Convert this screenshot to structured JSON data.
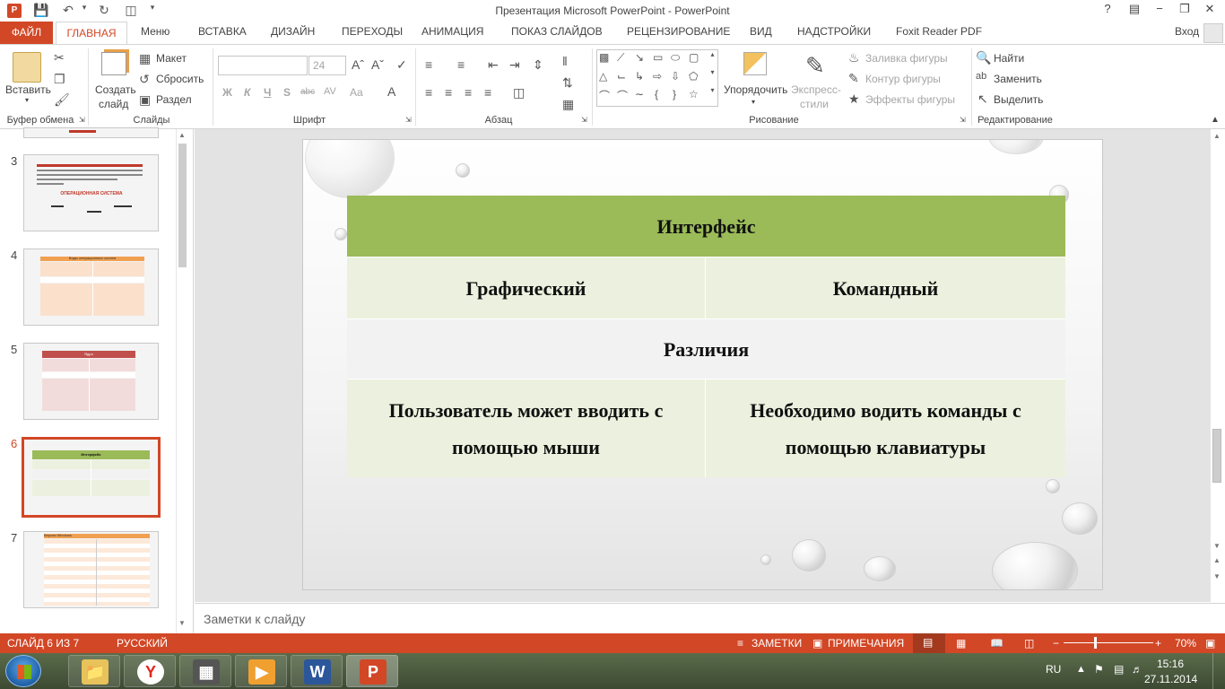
{
  "window": {
    "title": "Презентация Microsoft PowerPoint - PowerPoint",
    "help": "?",
    "minimize": "−",
    "restore": "❐",
    "close": "✕"
  },
  "tabs": {
    "file": "ФАЙЛ",
    "home": "ГЛАВНАЯ",
    "items": [
      "Меню",
      "ВСТАВКА",
      "ДИЗАЙН",
      "ПЕРЕХОДЫ",
      "АНИМАЦИЯ",
      "ПОКАЗ СЛАЙДОВ",
      "РЕЦЕНЗИРОВАНИЕ",
      "ВИД",
      "НАДСТРОЙКИ",
      "Foxit Reader PDF"
    ],
    "signin": "Вход"
  },
  "ribbon": {
    "clipboard": {
      "paste": "Вставить",
      "label": "Буфер обмена"
    },
    "slides": {
      "new_slide_line1": "Создать",
      "new_slide_line2": "слайд",
      "layout": "Макет",
      "reset": "Сбросить",
      "section": "Раздел",
      "label": "Слайды"
    },
    "font": {
      "size": "24",
      "bold": "Ж",
      "italic": "К",
      "underline": "Ч",
      "strike": "S",
      "abc": "abc",
      "spacing": "AV",
      "case": "Aa",
      "label": "Шрифт"
    },
    "paragraph": {
      "label": "Абзац"
    },
    "drawing": {
      "arrange": "Упорядочить",
      "quick_styles_line1": "Экспресс-",
      "quick_styles_line2": "стили",
      "fill": "Заливка фигуры",
      "outline": "Контур фигуры",
      "effects": "Эффекты фигуры",
      "label": "Рисование"
    },
    "editing": {
      "find": "Найти",
      "replace": "Заменить",
      "select": "Выделить",
      "label": "Редактирование"
    }
  },
  "thumbnails": [
    {
      "num": "3",
      "text": "ОПЕРАЦИОННАЯ СИСТЕМА"
    },
    {
      "num": "4",
      "text": "Виды операционных систем"
    },
    {
      "num": "5",
      "text": "Ядро"
    },
    {
      "num": "6",
      "text": "Интерфейс"
    },
    {
      "num": "7",
      "text": "Версия Windows"
    }
  ],
  "slide": {
    "header": "Интерфейс",
    "col1": "Графический",
    "col2": "Командный",
    "section": "Различия",
    "cell1_line1": "Пользователь может вводить с",
    "cell1_line2": "помощью мыши",
    "cell2_line1": "Необходимо водить команды с",
    "cell2_line2": "помощью клавиатуры"
  },
  "notes_placeholder": "Заметки к слайду",
  "status": {
    "slide_counter": "СЛАЙД 6 ИЗ 7",
    "language": "РУССКИЙ",
    "notes": "ЗАМЕТКИ",
    "comments": "ПРИМЕЧАНИЯ",
    "zoom": "70%",
    "zoom_fraction": 0.35
  },
  "taskbar": {
    "lang": "RU",
    "time": "15:16",
    "date": "27.11.2014",
    "apps": [
      "file-explorer",
      "yandex-browser",
      "media-app",
      "video-player",
      "word",
      "powerpoint"
    ]
  },
  "colors": {
    "accent": "#d24726",
    "header_green": "#9bbb59",
    "row_light": "#ebf1de",
    "row_white": "#f2f2f2"
  }
}
